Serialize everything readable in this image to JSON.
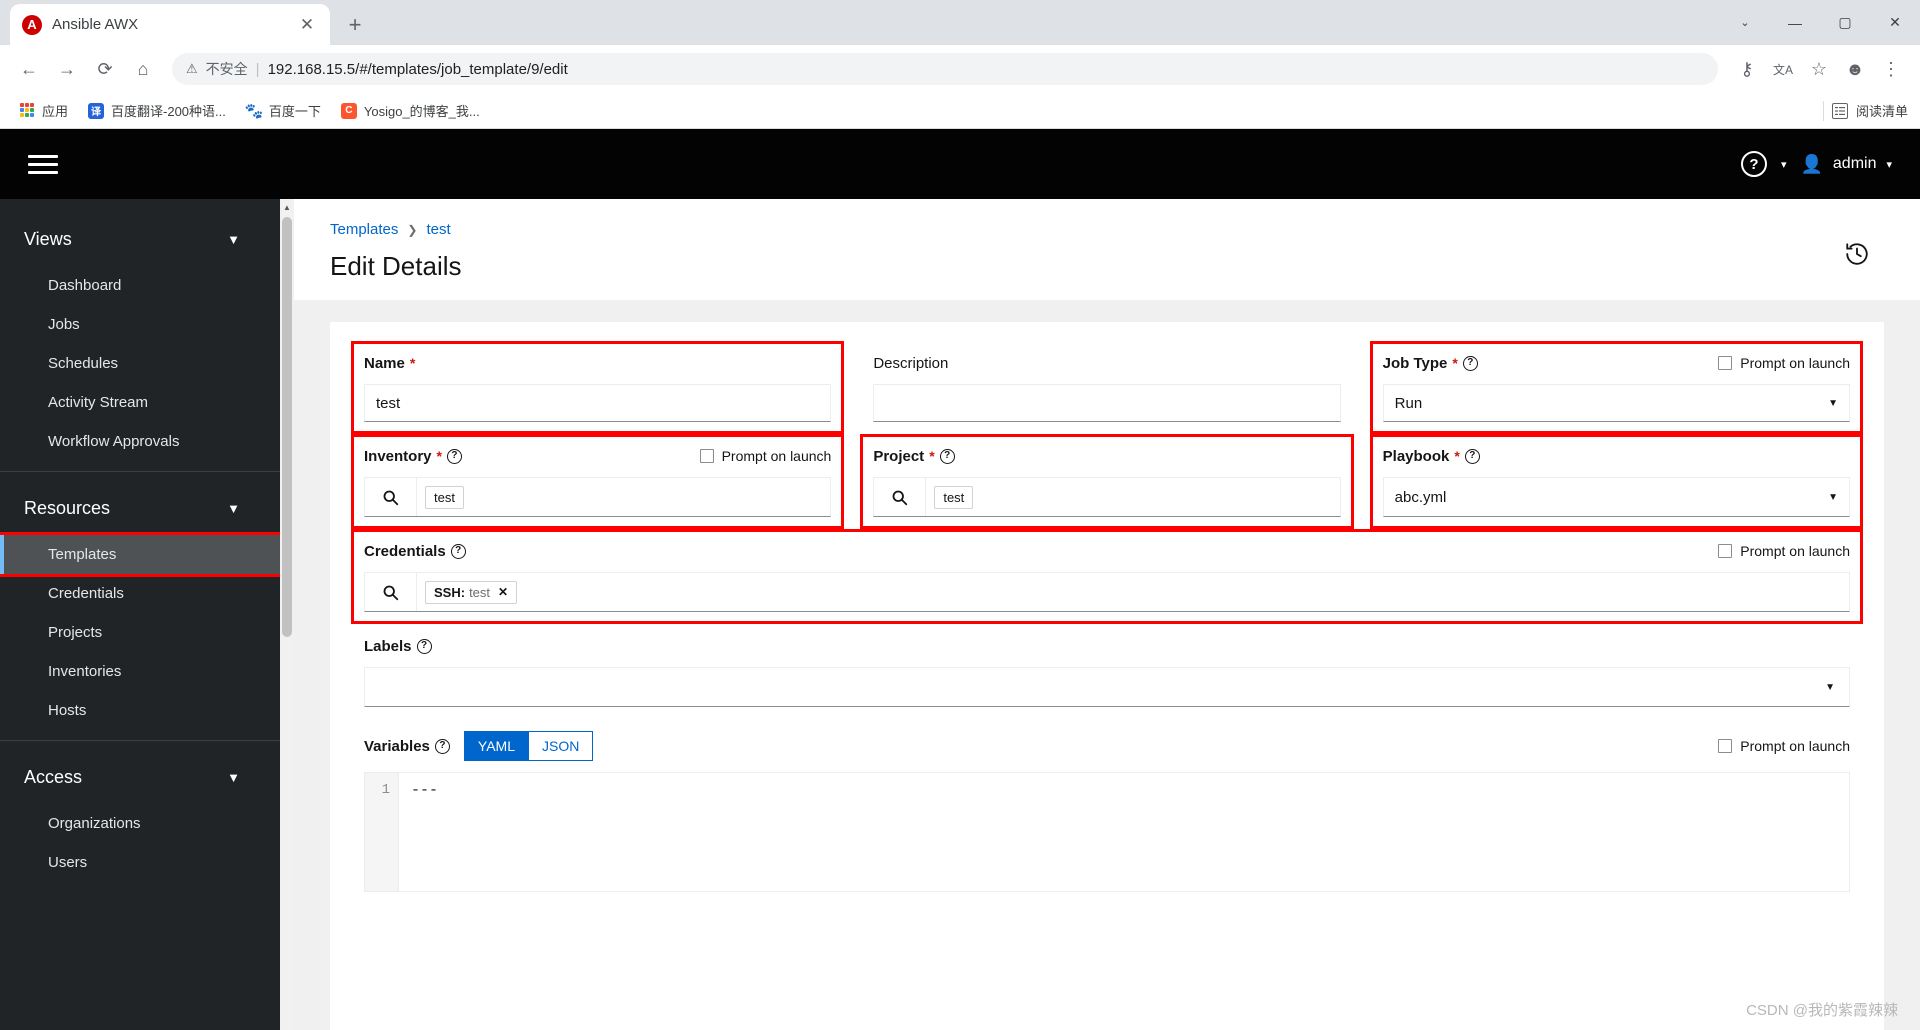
{
  "browser": {
    "tab": {
      "title": "Ansible AWX",
      "favicon_letter": "A",
      "close_label": "✕"
    },
    "new_tab_label": "+",
    "window_controls": {
      "minimize": "—",
      "maximize": "▢",
      "close": "✕",
      "chevron": "⌄"
    },
    "nav": {
      "back": "←",
      "forward": "→",
      "reload": "⟳",
      "home": "⌂"
    },
    "omnibox": {
      "warning_icon": "⚠",
      "security_text": "不安全",
      "separator": "|",
      "url": "192.168.15.5/#/templates/job_template/9/edit"
    },
    "toolbar_right": {
      "key": "⚷",
      "translate": "文A",
      "star": "☆",
      "profile": "☻",
      "menu": "⋮"
    },
    "bookmarks": [
      {
        "label": "应用",
        "icon": "apps-grid"
      },
      {
        "label": "百度翻译-200种语...",
        "icon": "译",
        "color": "#2563d9"
      },
      {
        "label": "百度一下",
        "icon": "baidu-paw",
        "color": "#2932e1"
      },
      {
        "label": "Yosigo_的博客_我...",
        "icon": "C",
        "color": "#fc5531"
      }
    ],
    "reading_list": "阅读清单"
  },
  "awx": {
    "header": {
      "hamburger": "menu-icon",
      "help": "?",
      "help_caret": "▾",
      "user_name": "admin",
      "user_caret": "▾"
    },
    "sidebar": {
      "groups": [
        {
          "title": "Views",
          "chevron": "⌄",
          "items": [
            {
              "label": "Dashboard",
              "active": false
            },
            {
              "label": "Jobs",
              "active": false
            },
            {
              "label": "Schedules",
              "active": false
            },
            {
              "label": "Activity Stream",
              "active": false
            },
            {
              "label": "Workflow Approvals",
              "active": false
            }
          ]
        },
        {
          "title": "Resources",
          "chevron": "⌄",
          "items": [
            {
              "label": "Templates",
              "active": true
            },
            {
              "label": "Credentials",
              "active": false
            },
            {
              "label": "Projects",
              "active": false
            },
            {
              "label": "Inventories",
              "active": false
            },
            {
              "label": "Hosts",
              "active": false
            }
          ]
        },
        {
          "title": "Access",
          "chevron": "⌄",
          "items": [
            {
              "label": "Organizations",
              "active": false
            },
            {
              "label": "Users",
              "active": false
            }
          ]
        }
      ]
    },
    "breadcrumb": {
      "root": "Templates",
      "separator": "❯",
      "current": "test"
    },
    "page_title": "Edit Details",
    "history_icon": "history-icon",
    "form": {
      "name": {
        "label": "Name",
        "required": "*",
        "value": "test",
        "highlighted": true
      },
      "description": {
        "label": "Description",
        "value": "",
        "placeholder": ""
      },
      "job_type": {
        "label": "Job Type",
        "required": "*",
        "help": "?",
        "value": "Run",
        "caret": "▼",
        "prompt_on_launch": "Prompt on launch",
        "prompt_checked": false,
        "highlighted": true
      },
      "inventory": {
        "label": "Inventory",
        "required": "*",
        "help": "?",
        "chip": "test",
        "search_icon": "search-icon",
        "prompt_on_launch": "Prompt on launch",
        "prompt_checked": false,
        "highlighted": true
      },
      "project": {
        "label": "Project",
        "required": "*",
        "help": "?",
        "chip": "test",
        "search_icon": "search-icon",
        "highlighted": true
      },
      "playbook": {
        "label": "Playbook",
        "required": "*",
        "help": "?",
        "value": "abc.yml",
        "caret": "▼",
        "highlighted": true
      },
      "credentials": {
        "label": "Credentials",
        "help": "?",
        "chip_prefix": "SSH:",
        "chip_value": "test",
        "chip_remove": "✕",
        "search_icon": "search-icon",
        "prompt_on_launch": "Prompt on launch",
        "prompt_checked": false,
        "highlighted": true
      },
      "labels": {
        "label": "Labels",
        "help": "?",
        "value": "",
        "caret": "▼"
      },
      "variables": {
        "label": "Variables",
        "help": "?",
        "modes": [
          {
            "label": "YAML",
            "active": true
          },
          {
            "label": "JSON",
            "active": false
          }
        ],
        "prompt_on_launch": "Prompt on launch",
        "prompt_checked": false,
        "line_number": "1",
        "code": "---"
      }
    },
    "watermark": "CSDN @我的紫霞辣辣"
  },
  "colors": {
    "accent_blue": "#0066cc",
    "highlight_red": "#ff0000",
    "sidebar_bg": "#212427",
    "header_bg": "#030303",
    "active_bar": "#73bcf7"
  }
}
